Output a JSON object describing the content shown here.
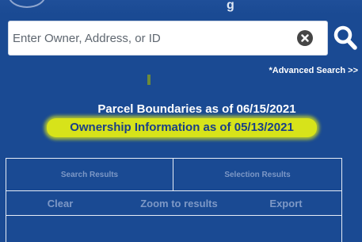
{
  "header": {
    "title_fragment": "g"
  },
  "search": {
    "placeholder": "Enter Owner, Address, or ID",
    "value": "",
    "clear_icon": "close-circle-icon",
    "search_icon": "magnifier-icon"
  },
  "advanced_search_label": "*Advanced Search >>",
  "info": {
    "parcel_boundaries": "Parcel Boundaries as of 06/15/2021",
    "ownership": "Ownership Information as of 05/13/2021"
  },
  "tabs": [
    {
      "label": "Search Results"
    },
    {
      "label": "Selection Results"
    }
  ],
  "actions": {
    "clear": "Clear",
    "zoom": "Zoom to results",
    "export": "Export"
  },
  "colors": {
    "background": "#1a4a93",
    "highlight": "#d7e31a",
    "muted_text": "#7d98c6"
  }
}
